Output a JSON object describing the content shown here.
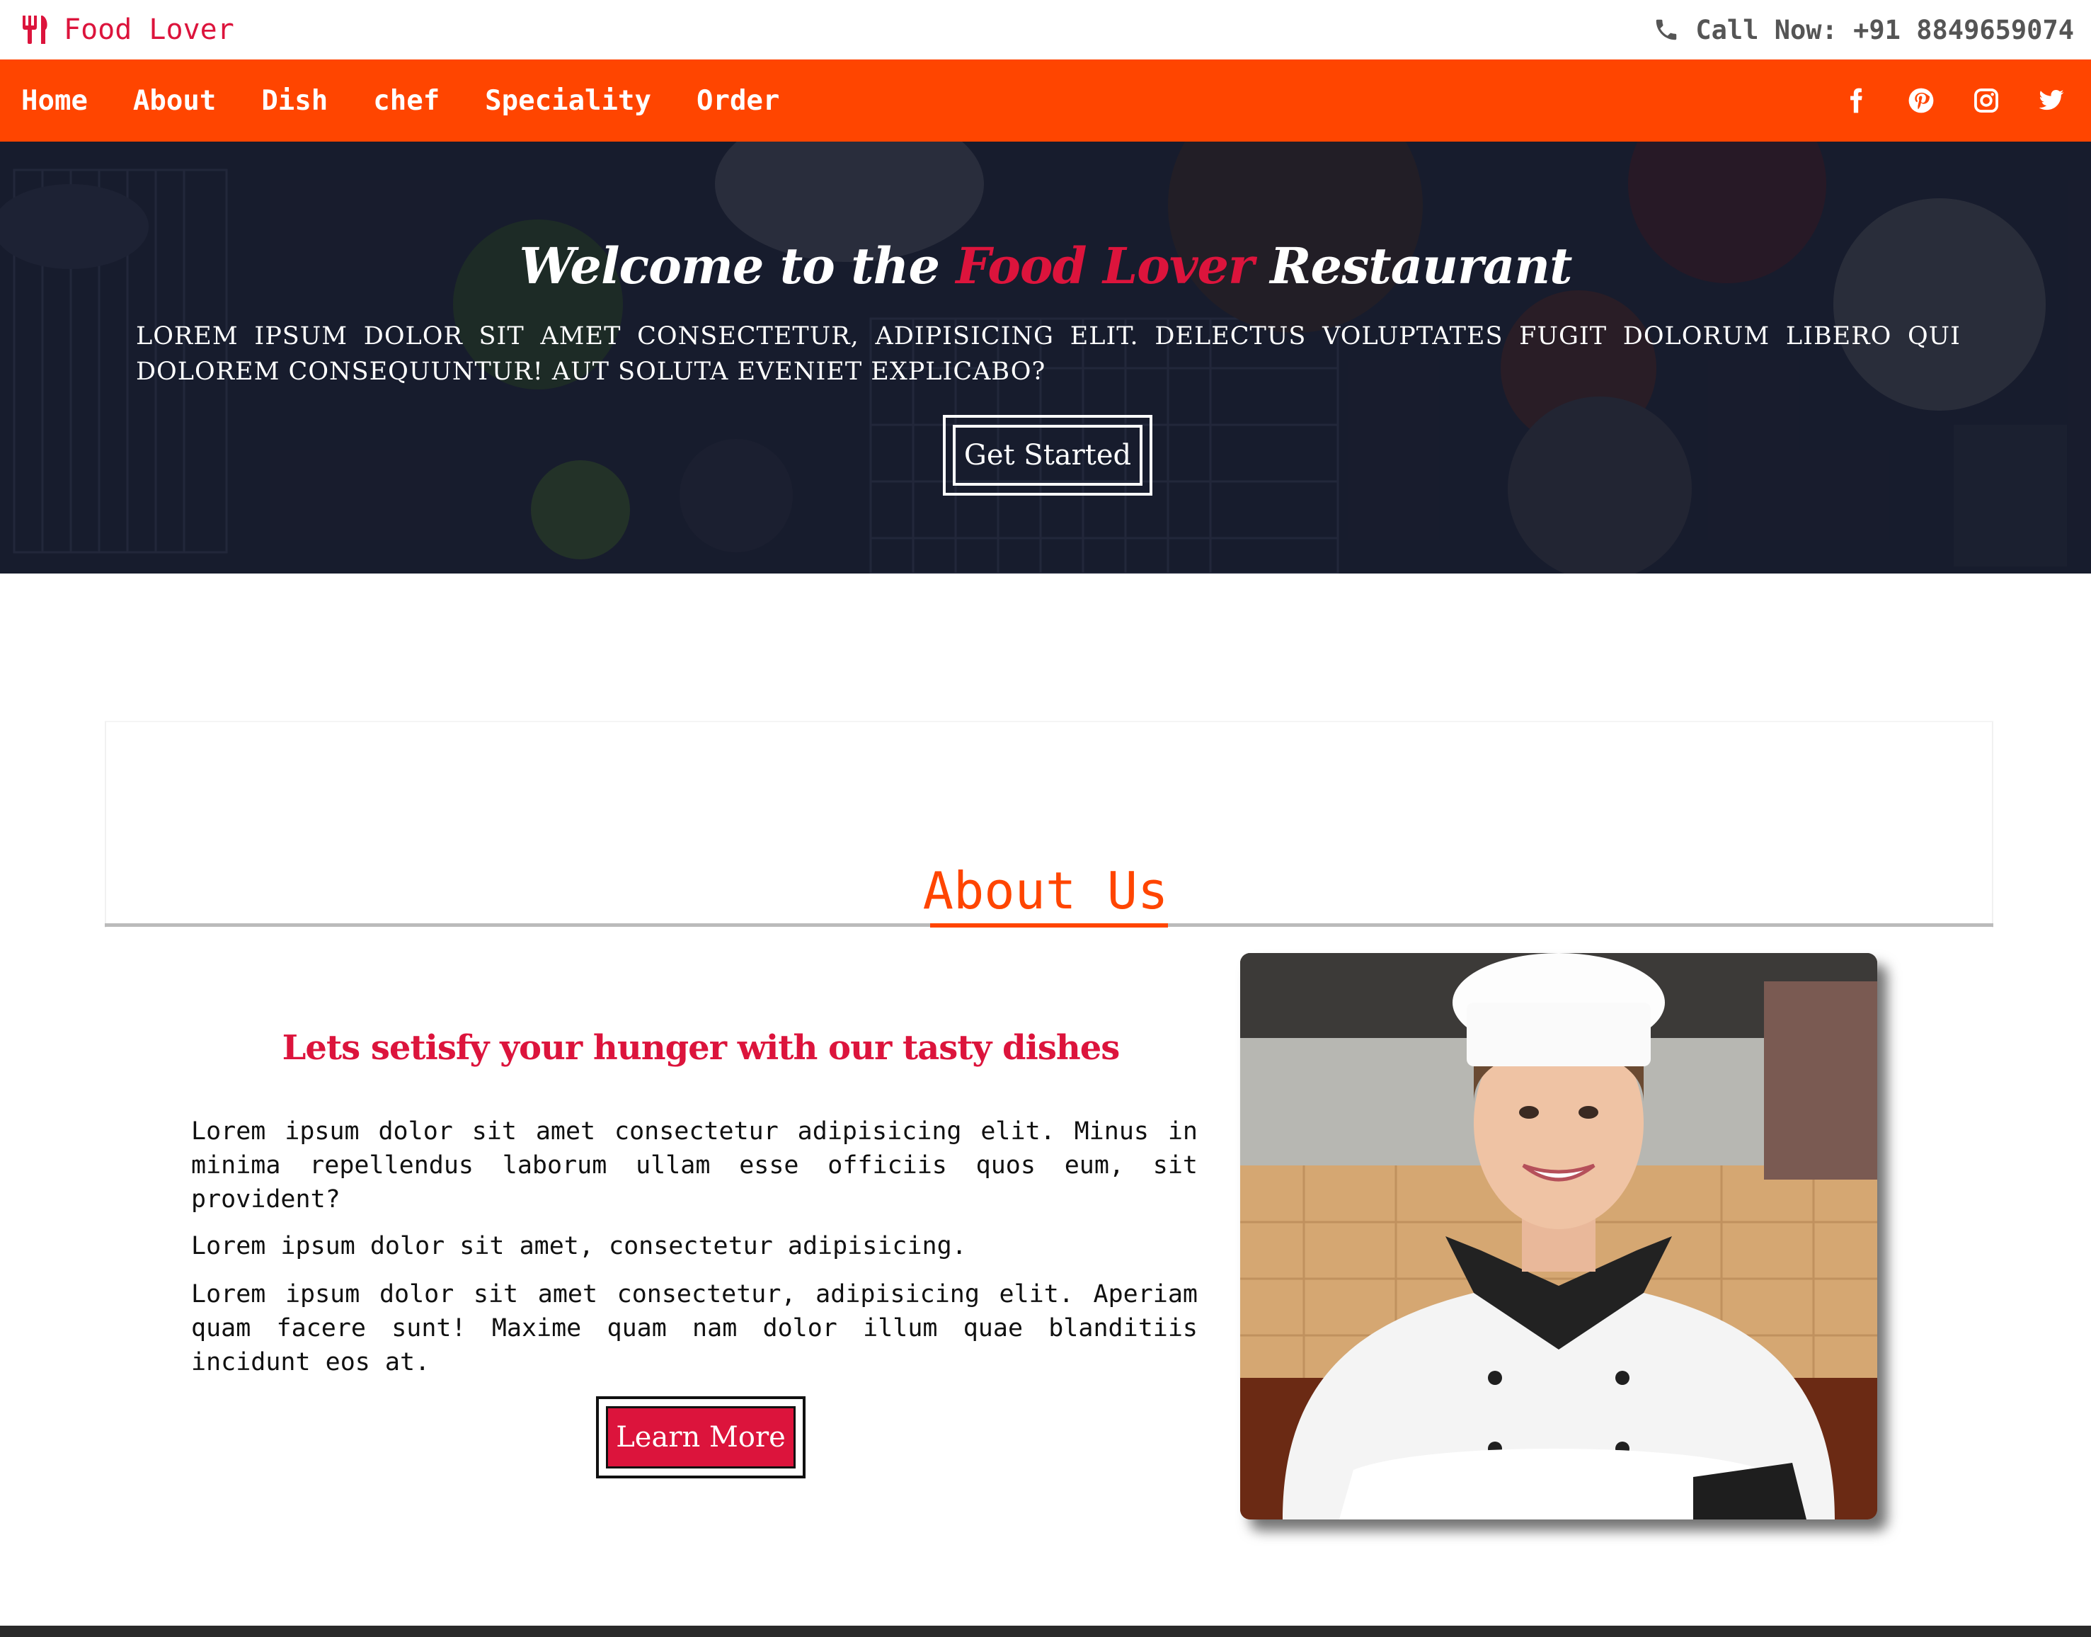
{
  "topbar": {
    "brand": "Food Lover",
    "brand_icon": "utensils-icon",
    "call": "Call Now: +91 8849659074",
    "call_icon": "phone-icon"
  },
  "nav": {
    "links": [
      "Home",
      "About",
      "Dish",
      "chef",
      "Speciality",
      "Order"
    ],
    "socials": [
      "facebook-icon",
      "pinterest-icon",
      "instagram-icon",
      "twitter-icon"
    ],
    "background": "#ff4500"
  },
  "hero": {
    "title_start": "Welcome to the ",
    "title_accent": "Food Lover",
    "title_end": " Restaurant",
    "text": "Lorem ipsum dolor sit amet consectetur, adipisicing elit. Delectus voluptates fugit dolorum libero qui dolorem consequuntur! Aut soluta eveniet explicabo?",
    "button": "Get Started"
  },
  "about": {
    "heading": "About Us",
    "tagline": "Lets setisfy your hunger with our tasty dishes",
    "paragraphs": [
      "Lorem ipsum dolor sit amet consectetur adipisicing elit. Minus in minima repellendus laborum ullam esse officiis quos eum, sit provident?",
      "Lorem ipsum dolor sit amet, consectetur adipisicing.",
      "Lorem ipsum dolor sit amet consectetur, adipisicing elit. Aperiam quam facere sunt! Maxime quam nam dolor illum quae blanditiis incidunt eos at."
    ],
    "button": "Learn More"
  },
  "colors": {
    "accent_red": "#dc143c",
    "accent_orange": "#ff4500"
  }
}
